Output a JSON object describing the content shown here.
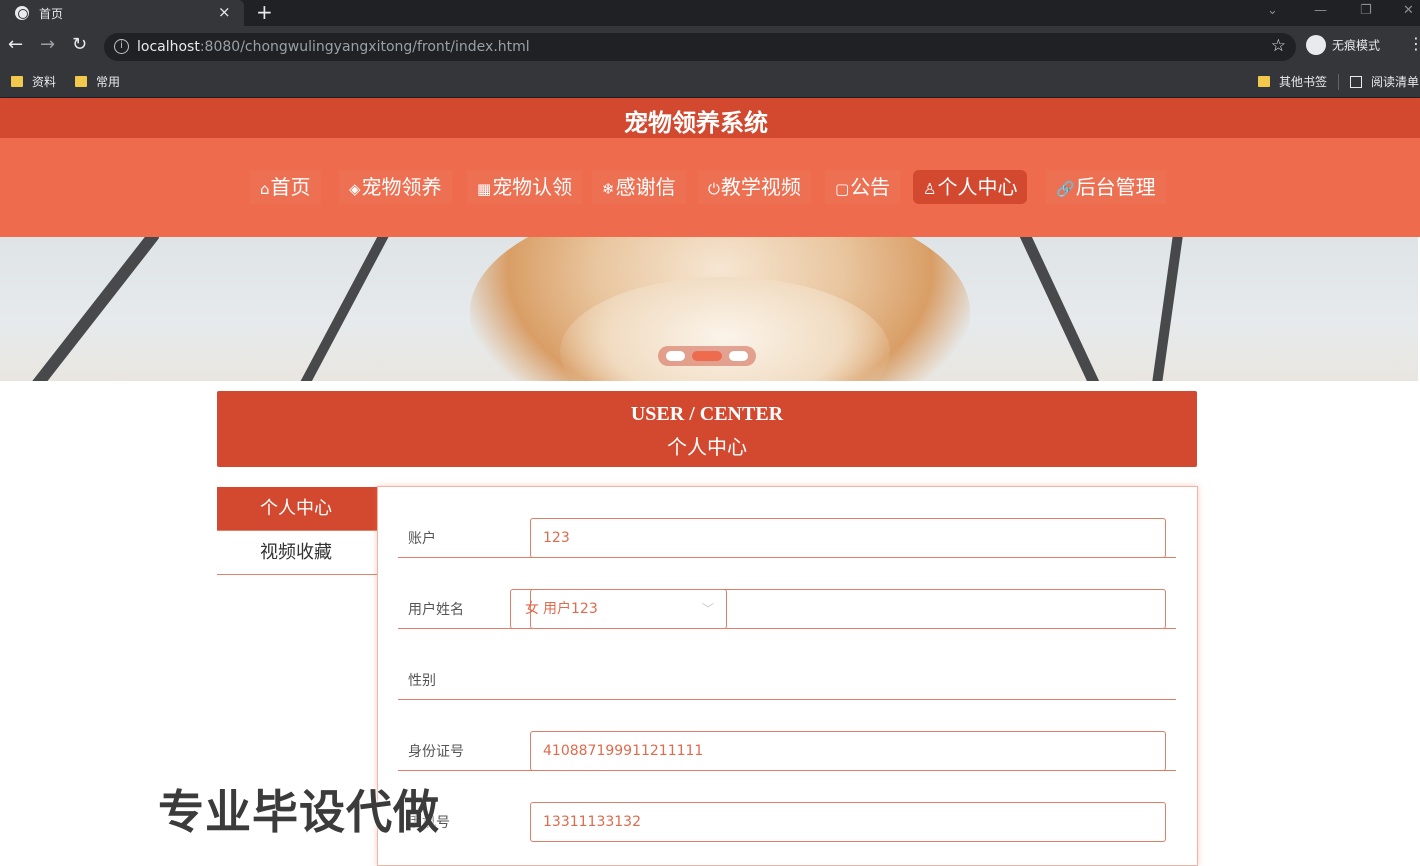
{
  "browser": {
    "tab_title": "首页",
    "tab_close": "×",
    "new_tab": "+",
    "url_host": "localhost",
    "url_rest": ":8080/chongwulingyangxitong/front/index.html",
    "incognito_label": "无痕模式",
    "bookmarks": [
      "资料",
      "常用"
    ],
    "bookmarks_right": [
      "其他书签",
      "阅读清单"
    ]
  },
  "site": {
    "title": "宠物领养系统",
    "nav": [
      {
        "icon": "⌂",
        "label": "首页"
      },
      {
        "icon": "◈",
        "label": "宠物领养"
      },
      {
        "icon": "▦",
        "label": "宠物认领"
      },
      {
        "icon": "❄",
        "label": "感谢信"
      },
      {
        "icon": "⏻",
        "label": "教学视频"
      },
      {
        "icon": "▢",
        "label": "公告"
      },
      {
        "icon": "♙",
        "label": "个人中心"
      },
      {
        "icon": "🔗",
        "label": "后台管理"
      }
    ],
    "active_nav_index": 6,
    "accent_color": "#d2492f",
    "nav_color": "#ee6b4d"
  },
  "user_center": {
    "title_en": "USER / CENTER",
    "title_cn": "个人中心",
    "side_menu": [
      "个人中心",
      "视频收藏"
    ],
    "fields": [
      {
        "label": "账户",
        "value": "123"
      },
      {
        "label": "用户姓名",
        "value": "用户123"
      },
      {
        "label": "性别",
        "value": "女"
      },
      {
        "label": "身份证号",
        "value": "410887199911211111"
      },
      {
        "label": "手机号",
        "value": "13311133132"
      }
    ]
  },
  "watermark": "专业毕设代做"
}
